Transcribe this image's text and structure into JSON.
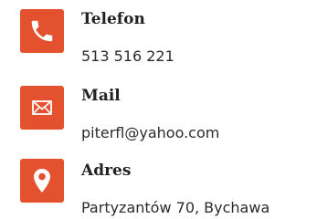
{
  "contacts": [
    {
      "label": "Telefon",
      "value": "513 516 221",
      "icon": "phone-icon"
    },
    {
      "label": "Mail",
      "value": "piterfl@yahoo.com",
      "icon": "envelope-icon"
    },
    {
      "label": "Adres",
      "value": "Partyzantów 70, Bychawa",
      "icon": "map-pin-icon"
    }
  ],
  "colors": {
    "icon_background": "#e4512f",
    "icon_foreground": "#ffffff",
    "label_text": "#222222",
    "value_text": "#2b2b2b"
  }
}
